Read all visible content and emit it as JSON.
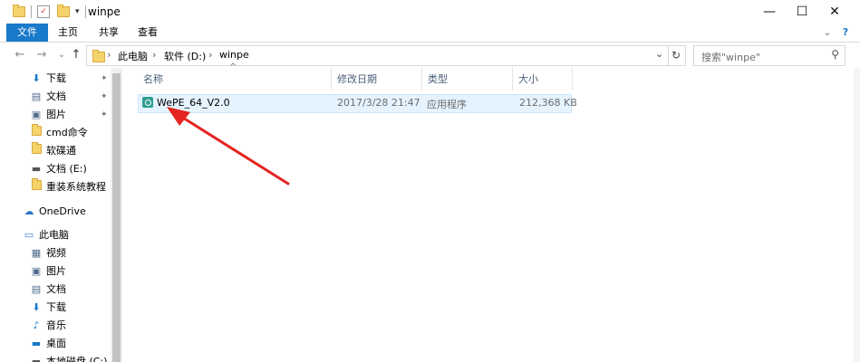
{
  "window": {
    "title": "winpe",
    "controls": {
      "minimize": "—",
      "maximize": "☐",
      "close": "✕"
    }
  },
  "ribbon": {
    "tabs": [
      "文件",
      "主页",
      "共享",
      "查看"
    ],
    "expand_glyph": "⌄",
    "help_glyph": "?"
  },
  "address": {
    "crumbs": [
      "此电脑",
      "软件 (D:)",
      "winpe"
    ],
    "separator": "›",
    "dropdown_glyph": "⌄",
    "refresh_glyph": "↻"
  },
  "search": {
    "placeholder": "搜索\"winpe\"",
    "icon": "search-icon"
  },
  "nav": {
    "back": "←",
    "forward": "→",
    "recent": "⌄",
    "up": "↑"
  },
  "sidebar": {
    "items": [
      {
        "label": "下载",
        "icon": "download-icon",
        "glyph": "⬇",
        "pinned": true
      },
      {
        "label": "文档",
        "icon": "document-icon",
        "glyph": "▤",
        "pinned": true
      },
      {
        "label": "图片",
        "icon": "picture-icon",
        "glyph": "▣",
        "pinned": true
      },
      {
        "label": "cmd命令",
        "icon": "folder-icon",
        "glyph": "",
        "pinned": false
      },
      {
        "label": "软碟通",
        "icon": "folder-icon",
        "glyph": "",
        "pinned": false
      },
      {
        "label": "文档 (E:)",
        "icon": "drive-icon",
        "glyph": "▬",
        "pinned": false
      },
      {
        "label": "重装系统教程",
        "icon": "folder-icon",
        "glyph": "",
        "pinned": false
      },
      {
        "label": "OneDrive",
        "icon": "cloud-icon",
        "glyph": "☁",
        "pinned": false
      },
      {
        "label": "此电脑",
        "icon": "computer-icon",
        "glyph": "▭",
        "pinned": false
      },
      {
        "label": "视频",
        "icon": "video-icon",
        "glyph": "▦",
        "pinned": false
      },
      {
        "label": "图片",
        "icon": "picture-icon",
        "glyph": "▣",
        "pinned": false
      },
      {
        "label": "文档",
        "icon": "document-icon",
        "glyph": "▤",
        "pinned": false
      },
      {
        "label": "下载",
        "icon": "download-icon",
        "glyph": "⬇",
        "pinned": false
      },
      {
        "label": "音乐",
        "icon": "music-icon",
        "glyph": "♪",
        "pinned": false
      },
      {
        "label": "桌面",
        "icon": "desktop-icon",
        "glyph": "▬",
        "pinned": false
      },
      {
        "label": "本地磁盘 (C:)",
        "icon": "drive-icon",
        "glyph": "▬",
        "pinned": false
      }
    ],
    "pin_glyph": "📌"
  },
  "columns": {
    "name": "名称",
    "modified": "修改日期",
    "type": "类型",
    "size": "大小",
    "sort_glyph": "^"
  },
  "files": [
    {
      "name": "WePE_64_V2.0",
      "modified": "2017/3/28 21:47",
      "type": "应用程序",
      "size": "212,368 KB"
    }
  ],
  "annotation": {
    "color": "#e52521",
    "shape": "red arrow pointing to the selected file"
  },
  "colors": {
    "accent": "#1979ca",
    "selection": "#e5f3ff",
    "header_text": "#4c607a"
  }
}
